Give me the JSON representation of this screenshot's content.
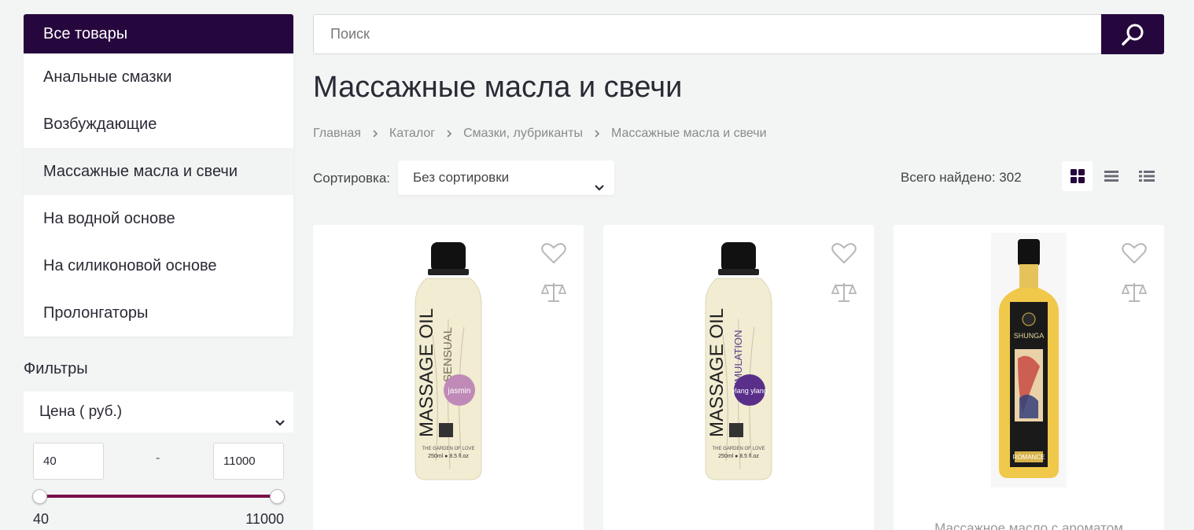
{
  "sidebar": {
    "title": "Все товары",
    "items": [
      {
        "label": "Анальные смазки"
      },
      {
        "label": "Возбуждающие"
      },
      {
        "label": "Массажные масла и свечи"
      },
      {
        "label": "На водной основе"
      },
      {
        "label": "На силиконовой основе"
      },
      {
        "label": "Пролонгаторы"
      }
    ],
    "active_index": 2
  },
  "filters": {
    "title": "Фильтры",
    "price": {
      "label": "Цена ( руб.)",
      "from_value": "40",
      "to_value": "11000",
      "dash": "-",
      "min_label": "40",
      "max_label": "11000"
    }
  },
  "search": {
    "placeholder": "Поиск",
    "icon": "search-icon"
  },
  "page": {
    "title": "Массажные масла и свечи"
  },
  "breadcrumb": [
    "Главная",
    "Каталог",
    "Смазки, лубриканты",
    "Массажные масла и свечи"
  ],
  "sort": {
    "label": "Сортировка:",
    "selected": "Без сортировки"
  },
  "results": {
    "found_text": "Всего найдено: 302"
  },
  "view_modes": [
    "grid-view-icon",
    "list-view-icon",
    "table-view-icon"
  ],
  "products": [
    {
      "brand_text": "MASSAGE OIL",
      "variant_text": "SENSUAL",
      "badge": "jasmin",
      "volume": "250ml ● 8.5 fl.oz",
      "maker": "THE GARDEN OF LOVE",
      "title": ""
    },
    {
      "brand_text": "MASSAGE OIL",
      "variant_text": "STIMULATION",
      "badge": "ylang ylang",
      "volume": "250ml ● 8.5 fl.oz",
      "maker": "THE GARDEN OF LOVE",
      "title": ""
    },
    {
      "brand_text": "SHUNGA",
      "variant_text": "ROMANCE",
      "title": "Массажное масло с ароматом"
    }
  ],
  "colors": {
    "brand_dark": "#26073d",
    "slider": "#7a0f4a",
    "background": "#f3f4f4"
  }
}
